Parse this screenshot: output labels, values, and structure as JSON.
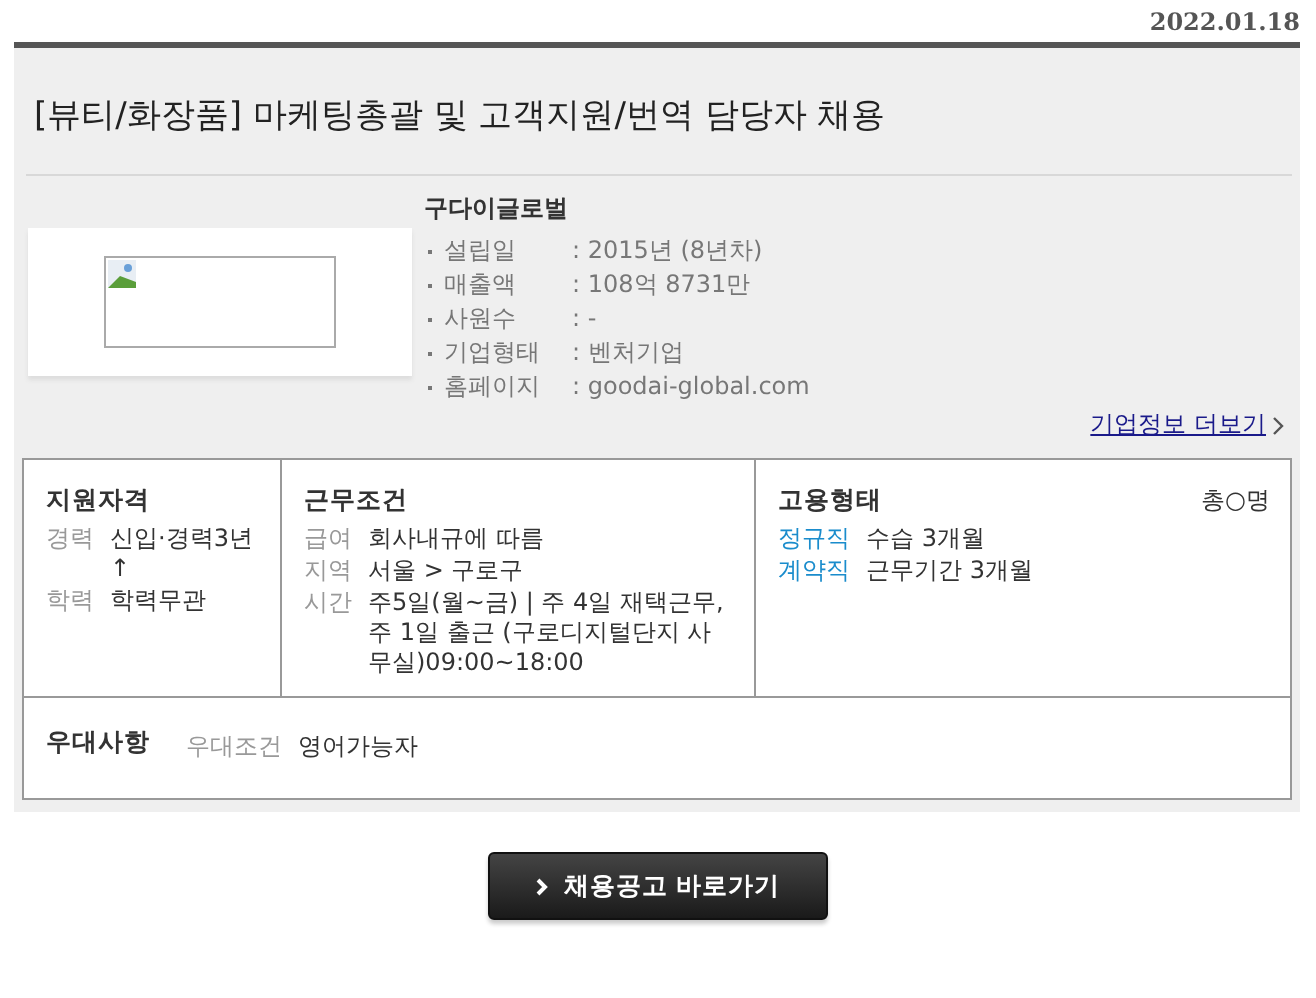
{
  "date": "2022.01.18",
  "title": "[뷰티/화장품] 마케팅총괄 및 고객지원/번역 담당자 채용",
  "company": {
    "name": "구다이글로벌",
    "info": [
      {
        "label": "설립일",
        "value": ": 2015년 (8년차)"
      },
      {
        "label": "매출액",
        "value": ": 108억 8731만"
      },
      {
        "label": "사원수",
        "value": ": -"
      },
      {
        "label": "기업형태",
        "value": ": 벤처기업"
      },
      {
        "label": "홈페이지",
        "value": ": goodai-global.com"
      }
    ],
    "more_link": "기업정보 더보기"
  },
  "qualifications": {
    "heading": "지원자격",
    "rows": [
      {
        "label": "경력",
        "value": "신입·경력3년↑"
      },
      {
        "label": "학력",
        "value": "학력무관"
      }
    ]
  },
  "conditions": {
    "heading": "근무조건",
    "rows": [
      {
        "label": "급여",
        "value": "회사내규에 따름"
      },
      {
        "label": "지역",
        "value": "서울 > 구로구"
      },
      {
        "label": "시간",
        "value": "주5일(월~금) | 주 4일 재택근무, 주 1일 출근 (구로디지털단지 사무실)09:00~18:00"
      }
    ]
  },
  "employment": {
    "heading": "고용형태",
    "count": "총○명",
    "rows": [
      {
        "label": "정규직",
        "value": "수습 3개월"
      },
      {
        "label": "계약직",
        "value": "근무기간 3개월"
      }
    ]
  },
  "preferences": {
    "heading": "우대사항",
    "label": "우대조건",
    "value": "영어가능자"
  },
  "button": "채용공고 바로가기"
}
